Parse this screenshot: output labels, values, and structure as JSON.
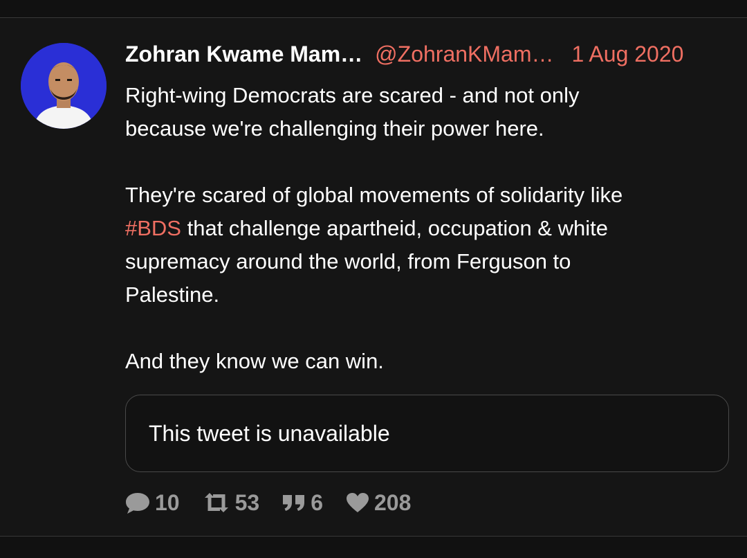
{
  "tweet": {
    "author_name": "Zohran Kwame Mam…",
    "handle": "@ZohranKMam…",
    "date": "1 Aug 2020",
    "text": {
      "para1_line1": "Right-wing Democrats are scared - and not only",
      "para1_line2": "because we're challenging their power here.",
      "para2_line1": "They're scared of global movements of solidarity like",
      "para2_hashtag": "#BDS",
      "para2_line2_rest": " that challenge apartheid, occupation & white",
      "para2_line3": "supremacy around the world, from Ferguson to",
      "para2_line4": "Palestine.",
      "para3": "And they know we can win."
    },
    "quoted_tweet": {
      "text": "This tweet is unavailable"
    },
    "stats": {
      "replies": "10",
      "retweets": "53",
      "quotes": "6",
      "likes": "208"
    }
  },
  "colors": {
    "background": "#151515",
    "accent": "#ef6f62",
    "text": "#ffffff",
    "muted": "#9a9a9a",
    "avatar_bg": "#2a2fd6"
  },
  "icons": {
    "replies": "speech-bubble-icon",
    "retweets": "retweet-icon",
    "quotes": "quote-icon",
    "likes": "heart-icon"
  }
}
